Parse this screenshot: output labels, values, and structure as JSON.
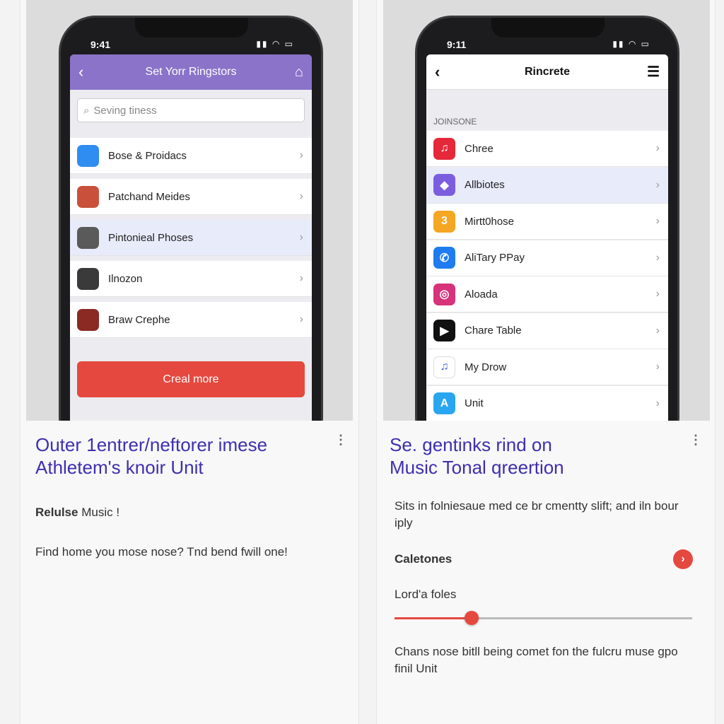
{
  "left": {
    "status_time": "9:41",
    "header_title": "Set Yorr Ringstors",
    "search_placeholder": "Seving tiness",
    "items": [
      {
        "label": "Bose & Proidacs",
        "icon": "app-store-icon",
        "color": "#2f8cf0"
      },
      {
        "label": "Patchand Meides",
        "icon": "colorful-app-icon",
        "color": "#c9513b"
      },
      {
        "label": "Pintonieal Phoses",
        "icon": "photo-thumbnail-icon",
        "color": "#5a5a5a",
        "selected": true
      },
      {
        "label": "Ilnozon",
        "icon": "camera-thumbnail-icon",
        "color": "#3a3a3a"
      },
      {
        "label": "Braw Crephe",
        "icon": "red-app-icon",
        "color": "#8a2a22"
      }
    ],
    "button_label": "Creal more",
    "card_title_1": "Outer 1entrer/neftorer imese",
    "card_title_2": "Athletem's knoir Unit",
    "subtitle_bold": "Relulse",
    "subtitle_rest": " Music !",
    "body": "Find home you mose nose? Tnd bend fwill one!"
  },
  "right": {
    "status_time": "9:11",
    "header_title": "Rincrete",
    "section_label": "JOINSONE",
    "items": [
      {
        "label": "Chree",
        "icon": "music-icon",
        "color": "#e5283a",
        "glyph": "♫"
      },
      {
        "label": "Allbiotes",
        "icon": "wave-icon",
        "color": "#7b5ee0",
        "glyph": "◆",
        "selected": true
      },
      {
        "label": "Mirtt0hose",
        "icon": "number-three-icon",
        "color": "#f5a623",
        "glyph": "3"
      },
      {
        "label": "AliTary PPay",
        "icon": "phone-icon",
        "color": "#1e7cf0",
        "glyph": "✆"
      },
      {
        "label": "Aloada",
        "icon": "instagram-icon",
        "color": "#d6337a",
        "glyph": "◎"
      },
      {
        "label": "Chare Table",
        "icon": "play-icon",
        "color": "#111111",
        "glyph": "▶"
      },
      {
        "label": "My Drow",
        "icon": "music-note-icon",
        "color": "#ffffff",
        "glyph": "♫"
      },
      {
        "label": "Unit",
        "icon": "app-store-icon",
        "color": "#2aa6f0",
        "glyph": "A"
      }
    ],
    "card_title_1": "Se. gentinks rind on",
    "card_title_2": "Music Tonal qreertion",
    "body1": "Sits in folniesaue med ce br cmentty slift; and iln bour iply",
    "row_label": "Caletones",
    "slider_label": "Lord'a foles",
    "slider_value": 0.26,
    "body2": "Chans nose bitll being comet fon the fulcru muse gpo finil Unit"
  },
  "colors": {
    "accent_purple": "#8a73c9",
    "accent_red": "#e5483f",
    "title_blue": "#3d2fb0"
  }
}
